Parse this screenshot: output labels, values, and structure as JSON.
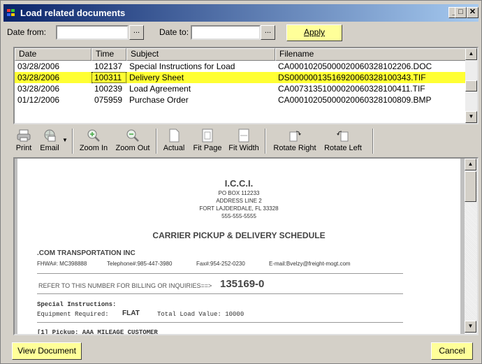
{
  "window": {
    "title": "Load related documents",
    "controls": {
      "minimize": "_",
      "maximize": "□",
      "close": "✕"
    }
  },
  "filter": {
    "date_from_label": "Date from:",
    "date_to_label": "Date to:",
    "date_from_value": "",
    "date_to_value": "",
    "picker_label": "...",
    "apply_label": "Apply"
  },
  "grid": {
    "columns": [
      "Date",
      "Time",
      "Subject",
      "Filename"
    ],
    "rows": [
      {
        "date": "03/28/2006",
        "time": "102137",
        "subject": "Special Instructions for Load",
        "filename": "CA00010205000020060328102206.DOC"
      },
      {
        "date": "03/28/2006",
        "time": "100311",
        "subject": "Delivery Sheet",
        "filename": "DS00000013516920060328100343.TIF"
      },
      {
        "date": "03/28/2006",
        "time": "100239",
        "subject": "Load Agreement",
        "filename": "CA00731351000020060328100411.TIF"
      },
      {
        "date": "01/12/2006",
        "time": "075959",
        "subject": "Purchase Order",
        "filename": "CA00010205000020060328100809.BMP"
      }
    ],
    "selected_row": 1
  },
  "toolbar": {
    "print": "Print",
    "email": "Email",
    "zoom_in": "Zoom In",
    "zoom_out": "Zoom Out",
    "actual": "Actual",
    "fit_page": "Fit Page",
    "fit_width": "Fit Width",
    "rotate_right": "Rotate Right",
    "rotate_left": "Rotate Left"
  },
  "document": {
    "company": "I.C.C.I.",
    "address1": "PO BOX 112233",
    "address2": "ADDRESS LINE 2",
    "city": "FORT LAJDERDALE, FL  33328",
    "phone": "555-555-5555",
    "heading": "CARRIER PICKUP & DELIVERY SCHEDULE",
    "carrier": ".COM TRANSPORTATION INC",
    "fhwa": "FHWA#: MC398888",
    "telephone": "Telephone#:985-447-3980",
    "fax": "Fax#:954-252-0230",
    "email": "E-mail:Bvelzy@freight-mogt.com",
    "refer": "REFER TO THIS NUMBER FOR BILLING OR INQUIRIES==>",
    "refer_number": "135169-0",
    "special": "Special Instructions:",
    "equipment_label": "Equipment Required:",
    "equipment_value": "FLAT",
    "total_label": "Total Load Value: 10000",
    "pickup": "[1] Pickup: AAA MILEAGE CUSTOMER"
  },
  "buttons": {
    "view_document": "View Document",
    "cancel": "Cancel"
  },
  "colors": {
    "title_start": "#0a246a",
    "title_end": "#a6caf0",
    "selection": "#ffff33",
    "button_bg": "#ffff99"
  }
}
